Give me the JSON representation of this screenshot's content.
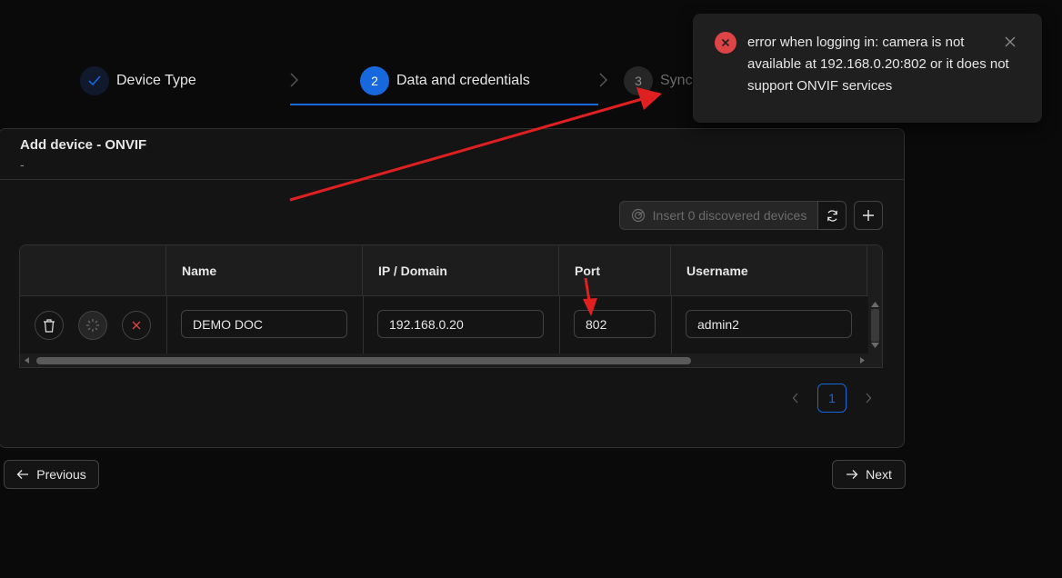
{
  "steps": [
    {
      "label": "Device Type",
      "state": "done"
    },
    {
      "number": "2",
      "label": "Data and credentials",
      "state": "active"
    },
    {
      "number": "3",
      "label": "Synch",
      "state": "pending"
    }
  ],
  "card": {
    "title": "Add device - ONVIF",
    "subtitle": "-"
  },
  "toolbar": {
    "insert_label": "Insert 0 discovered devices"
  },
  "table": {
    "columns": [
      "Name",
      "IP / Domain",
      "Port",
      "Username"
    ],
    "rows": [
      {
        "name": "DEMO DOC",
        "ip": "192.168.0.20",
        "port": "802",
        "username": "admin2"
      }
    ]
  },
  "pagination": {
    "current": "1"
  },
  "footer": {
    "previous_label": "Previous",
    "next_label": "Next"
  },
  "notification": {
    "type": "error",
    "message": "error when logging in: camera is not available at 192.168.0.20:802 or it does not support ONVIF services"
  },
  "colors": {
    "accent": "#1668dc",
    "error": "#dc4446",
    "annotation": "#e02020"
  }
}
